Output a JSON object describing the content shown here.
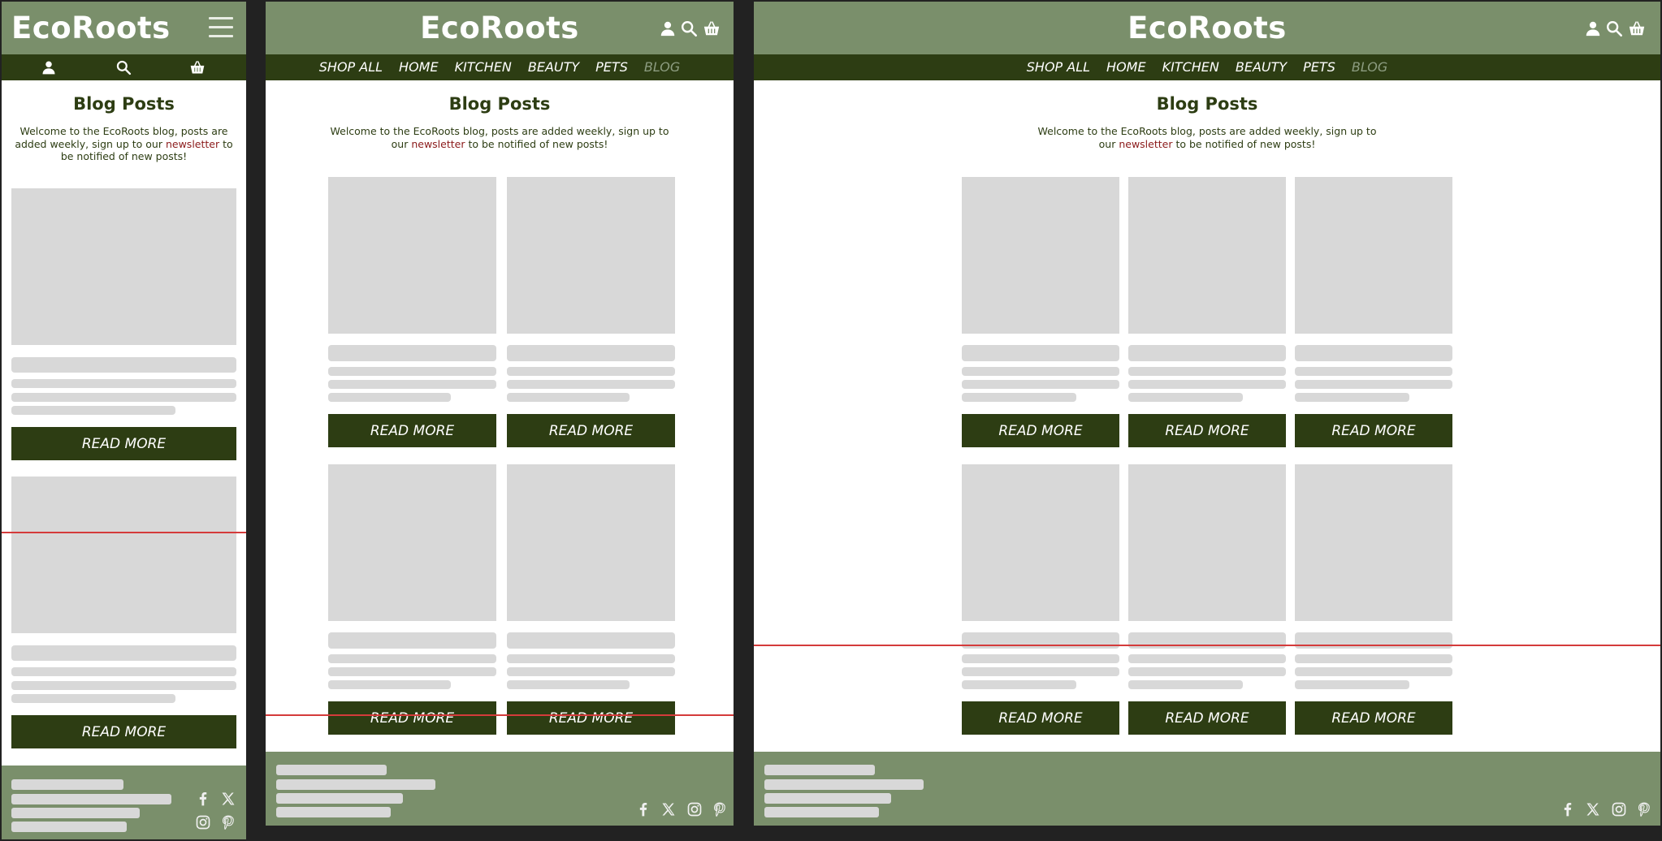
{
  "brand": {
    "name": "EcoRoots"
  },
  "nav": {
    "items": [
      {
        "label": "SHOP ALL",
        "active": false
      },
      {
        "label": "HOME",
        "active": false
      },
      {
        "label": "KITCHEN",
        "active": false
      },
      {
        "label": "BEAUTY",
        "active": false
      },
      {
        "label": "PETS",
        "active": false
      },
      {
        "label": "BLOG",
        "active": true
      }
    ]
  },
  "page": {
    "title": "Blog Posts",
    "intro_before": "Welcome to the EcoRoots blog, posts are added weekly, sign up to our ",
    "intro_link": "newsletter",
    "intro_after": " to be notified of new posts!"
  },
  "cards": {
    "button_label": "READ MORE"
  },
  "header_icons": [
    "user-icon",
    "search-icon",
    "basket-icon"
  ],
  "footer": {
    "social_icons": [
      "facebook-icon",
      "x-icon",
      "instagram-icon",
      "pinterest-icon"
    ]
  },
  "colors": {
    "header_bg": "#7a8f6b",
    "nav_bg": "#2d3d13",
    "nav_active": "#8d9d81",
    "accent_link": "#8b1a1a",
    "placeholder": "#d8d8d8",
    "scroll_marker": "#d43b3b"
  }
}
